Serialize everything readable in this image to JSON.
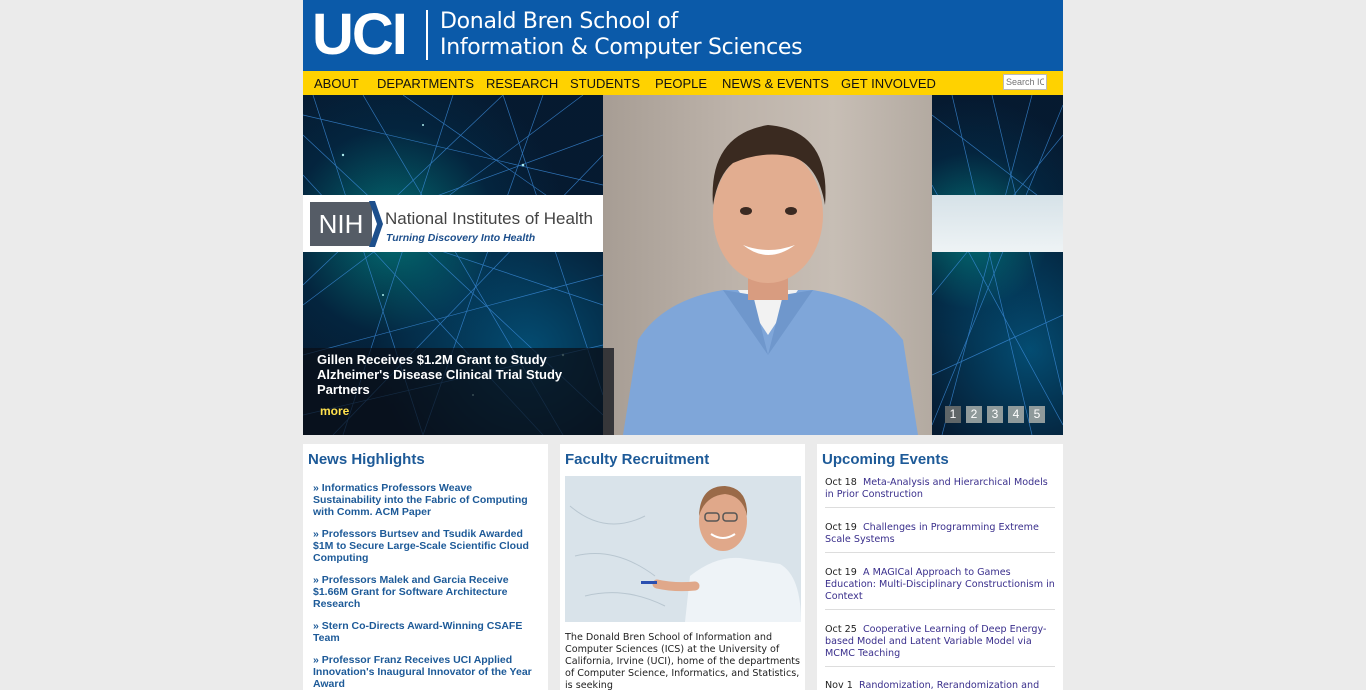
{
  "header": {
    "logo_text": "UCI",
    "school_line1": "Donald Bren School of",
    "school_line2": "Information & Computer Sciences",
    "bg_color": "#0b5aa9"
  },
  "nav": {
    "items": [
      "ABOUT",
      "DEPARTMENTS",
      "RESEARCH",
      "STUDENTS",
      "PEOPLE",
      "NEWS & EVENTS",
      "GET INVOLVED"
    ],
    "search_placeholder": "Search ICS",
    "bg_color": "#ffd200"
  },
  "hero": {
    "nih_abbrev": "NIH",
    "nih_name": "National Institutes of Health",
    "nih_tagline": "Turning Discovery Into Health",
    "caption_title": "Gillen Receives $1.2M Grant to Study Alzheimer's Disease Clinical Trial Study Partners",
    "more_label": "more",
    "pager": [
      "1",
      "2",
      "3",
      "4",
      "5"
    ],
    "active_page": "1"
  },
  "news": {
    "title": "News Highlights",
    "items": [
      "Informatics Professors Weave Sustainability into the Fabric of Computing with Comm. ACM Paper",
      "Professors Burtsev and Tsudik Awarded $1M to Secure Large-Scale Scientific Cloud Computing",
      "Professors Malek and Garcia Receive $1.66M Grant for Software Architecture Research",
      "Stern Co-Directs Award-Winning CSAFE Team",
      "Professor Franz Receives UCI Applied Innovation's Inaugural Innovator of the Year Award"
    ]
  },
  "faculty": {
    "title": "Faculty Recruitment",
    "text": "The Donald Bren School of Information and Computer Sciences (ICS) at the University of California, Irvine (UCI), home of the departments of Computer Science, Informatics, and Statistics, is seeking"
  },
  "events": {
    "title": "Upcoming Events",
    "items": [
      {
        "date": "Oct 18",
        "title": "Meta-Analysis and Hierarchical Models in Prior Construction"
      },
      {
        "date": "Oct 19",
        "title": "Challenges in Programming Extreme Scale Systems"
      },
      {
        "date": "Oct 19",
        "title": "A MAGICal Approach to Games Education: Multi-Disciplinary Constructionism in Context"
      },
      {
        "date": "Oct 25",
        "title": "Cooperative Learning of Deep Energy-based Model and Latent Variable Model via MCMC Teaching"
      },
      {
        "date": "Nov 1",
        "title": "Randomization, Rerandomization and"
      }
    ]
  }
}
